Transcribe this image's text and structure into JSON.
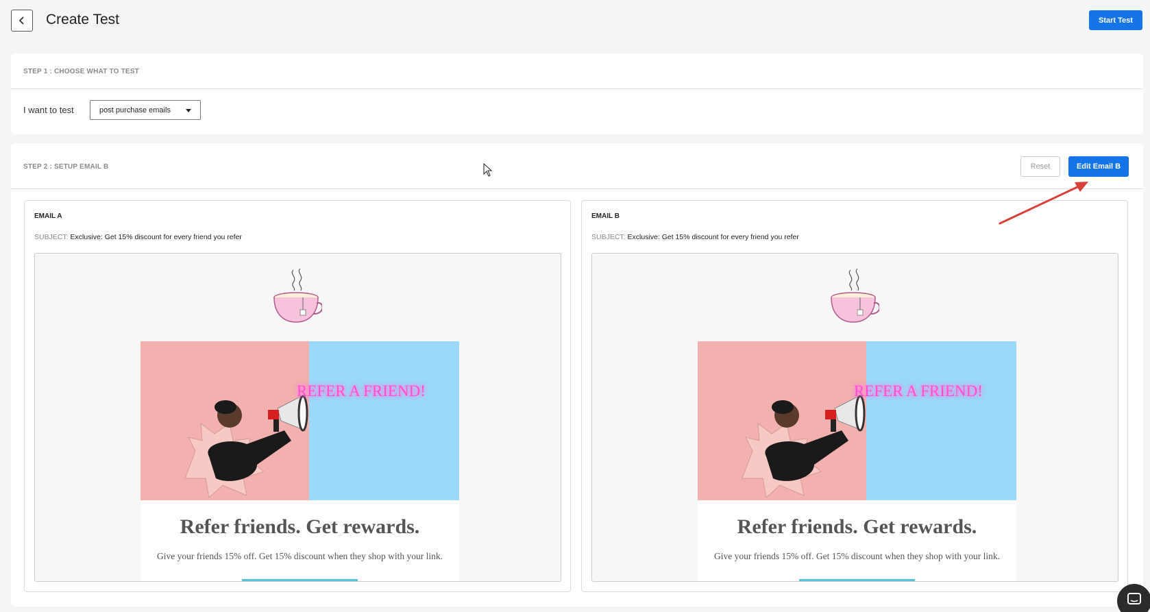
{
  "header": {
    "title": "Create Test",
    "start_button": "Start Test",
    "back_icon": "chevron-left-icon"
  },
  "step1": {
    "label": "STEP 1 : CHOOSE WHAT TO TEST",
    "want_label": "I want to test",
    "select_value": "post purchase emails"
  },
  "step2": {
    "label": "STEP 2 : SETUP EMAIL B",
    "reset_button": "Reset",
    "edit_button": "Edit Email B"
  },
  "emails": [
    {
      "label": "EMAIL A",
      "subject_key": "SUBJECT:",
      "subject": "Exclusive: Get 15% discount for every friend you refer",
      "banner_text": "REFER A FRIEND!",
      "headline": "Refer friends. Get rewards.",
      "body": "Give your friends 15% off. Get 15% discount when they shop with your link."
    },
    {
      "label": "EMAIL B",
      "subject_key": "SUBJECT:",
      "subject": "Exclusive: Get 15% discount for every friend you refer",
      "banner_text": "REFER A FRIEND!",
      "headline": "Refer friends. Get rewards.",
      "body": "Give your friends 15% off. Get 15% discount when they shop with your link."
    }
  ],
  "colors": {
    "primary": "#1474e8",
    "annotation_arrow": "#d9403a",
    "hero_pink": "#f2b0ae",
    "hero_blue": "#9ad9f8",
    "neon_text": "#ff4fd0",
    "cta": "#56c2d6"
  }
}
